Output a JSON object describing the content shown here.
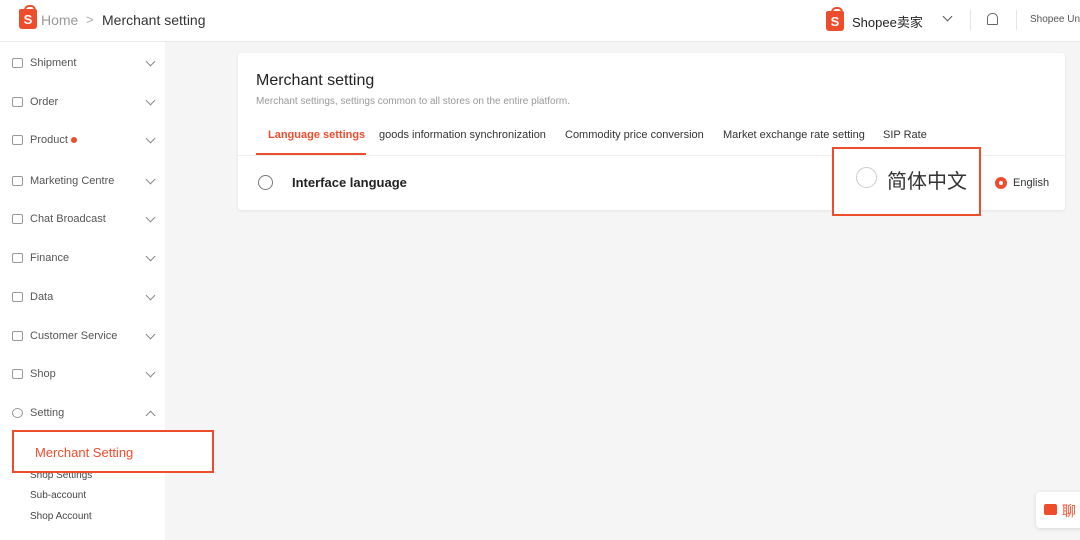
{
  "header": {
    "breadcrumb_home": "Home",
    "breadcrumb_sep": ">",
    "breadcrumb_current": "Merchant setting",
    "brand": "Shopee卖家",
    "logo_letter": "S",
    "account": "Shopee Uni"
  },
  "sidebar": {
    "items": [
      {
        "label": "Shipment"
      },
      {
        "label": "Order"
      },
      {
        "label": "Product"
      },
      {
        "label": "Marketing Centre"
      },
      {
        "label": "Chat Broadcast"
      },
      {
        "label": "Finance"
      },
      {
        "label": "Data"
      },
      {
        "label": "Customer Service"
      },
      {
        "label": "Shop"
      },
      {
        "label": "Setting"
      }
    ],
    "submenu": [
      {
        "label": "Merchant Setting"
      },
      {
        "label": "Shop Settings"
      },
      {
        "label": "Sub-account"
      },
      {
        "label": "Shop Account"
      }
    ]
  },
  "main": {
    "title": "Merchant setting",
    "subtitle": "Merchant settings, settings common to all stores on the entire platform.",
    "tabs": [
      {
        "label": "Language settings",
        "active": true
      },
      {
        "label": "goods information synchronization"
      },
      {
        "label": "Commodity price conversion"
      },
      {
        "label": "Market exchange rate setting"
      },
      {
        "label": "SIP Rate"
      }
    ],
    "interface_language": "Interface language",
    "options": [
      {
        "label": "简体中文",
        "selected": false
      },
      {
        "label": "English",
        "selected": true
      }
    ]
  },
  "chat": {
    "label": "聊"
  },
  "colors": {
    "accent": "#ee4d2d"
  }
}
